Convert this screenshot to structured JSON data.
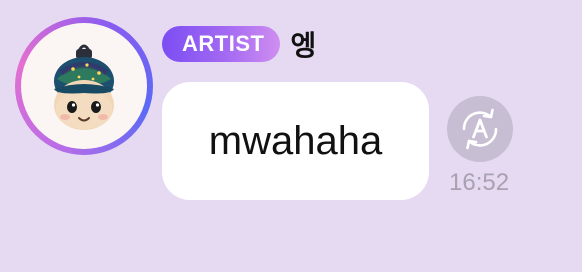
{
  "message": {
    "badge_label": "ARTIST",
    "sender_name": "엥",
    "text": "mwahaha",
    "timestamp": "16:52"
  },
  "icons": {
    "avatar": "plush-toy-avatar",
    "translate": "translate-icon"
  },
  "colors": {
    "background": "#e5daf2",
    "bubble": "#ffffff",
    "badge_gradient_start": "#7b4df3",
    "badge_gradient_end": "#cf8ef0",
    "timestamp": "#a8a2b0",
    "translate_button": "#c7bed3"
  }
}
